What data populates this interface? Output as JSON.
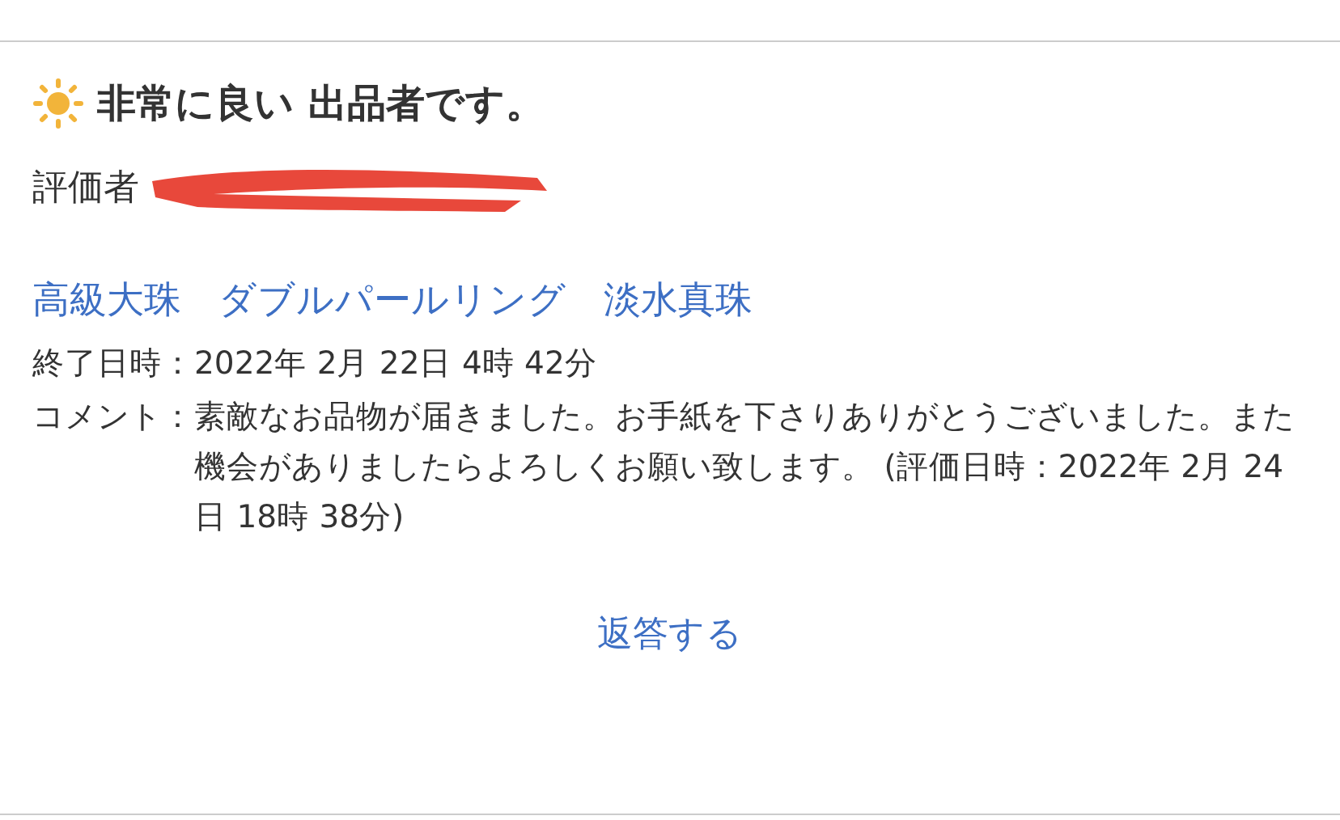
{
  "rating": {
    "title": "非常に良い 出品者です。"
  },
  "reviewer": {
    "label": "評価者"
  },
  "item": {
    "link": "高級大珠　ダブルパールリング　淡水真珠"
  },
  "details": [
    {
      "label": "終了日時：",
      "value": "2022年 2月 22日 4時 42分"
    },
    {
      "label": "コメント：",
      "value": "素敵なお品物が届きました。お手紙を下さりありがとうございました。また機会がありましたらよろしくお願い致します。 (評価日時：2022年 2月 24日 18時 38分)"
    }
  ],
  "reply": {
    "label": "返答する"
  }
}
